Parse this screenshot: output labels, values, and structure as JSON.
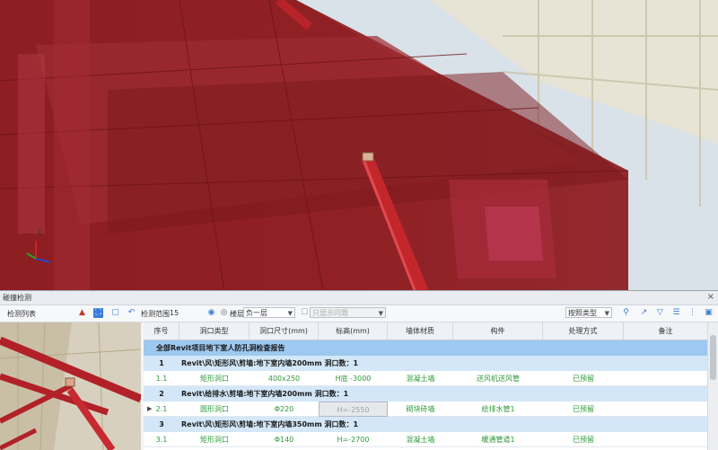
{
  "panel": {
    "title": "碰撞检测",
    "close": "×"
  },
  "toolbar": {
    "left_label": "检测列表",
    "label_range": "检测范围",
    "range_value": "15",
    "label_floor": "楼层",
    "floor_value": "负一层",
    "check_label": "只显示问题",
    "filter_value": "按照类型"
  },
  "table": {
    "columns": [
      "序号",
      "洞口类型",
      "洞口尺寸(mm)",
      "标高(mm)",
      "墙体材质",
      "构件",
      "处理方式",
      "备注"
    ],
    "category": "全部Revit项目地下室人防孔洞检查报告",
    "rows": [
      {
        "kind": "sub",
        "no": "1",
        "text": "Revit\\风\\矩形风\\剪墙:地下室内墙200mm  洞口数：1"
      },
      {
        "kind": "detail",
        "cells": [
          "1.1",
          "矩形洞口",
          "400x250",
          "H底 -3000",
          "混凝土墙",
          "送风机送风管",
          "已预留",
          ""
        ]
      },
      {
        "kind": "sub",
        "no": "2",
        "text": "Revit\\给排水\\剪墙:地下室内墙200mm  洞口数：1"
      },
      {
        "kind": "detail",
        "cells": [
          "2.1",
          "圆形洞口",
          "Φ220",
          "H=-2550",
          "砌块砖墙",
          "给排水管1",
          "已预留",
          ""
        ]
      },
      {
        "kind": "sub",
        "no": "3",
        "text": "Revit\\风\\矩形风\\剪墙:地下室内墙350mm  洞口数：1"
      },
      {
        "kind": "detail",
        "cells": [
          "3.1",
          "矩形洞口",
          "Φ140",
          "H=-2700",
          "混凝土墙",
          "暖通管道1",
          "已预留",
          ""
        ]
      }
    ]
  },
  "colors": {
    "group_row": "#9dc8ef",
    "sub_row": "#d3e7f8",
    "detail_text": "#2e9a3a",
    "model_red": "#8e1d22"
  }
}
